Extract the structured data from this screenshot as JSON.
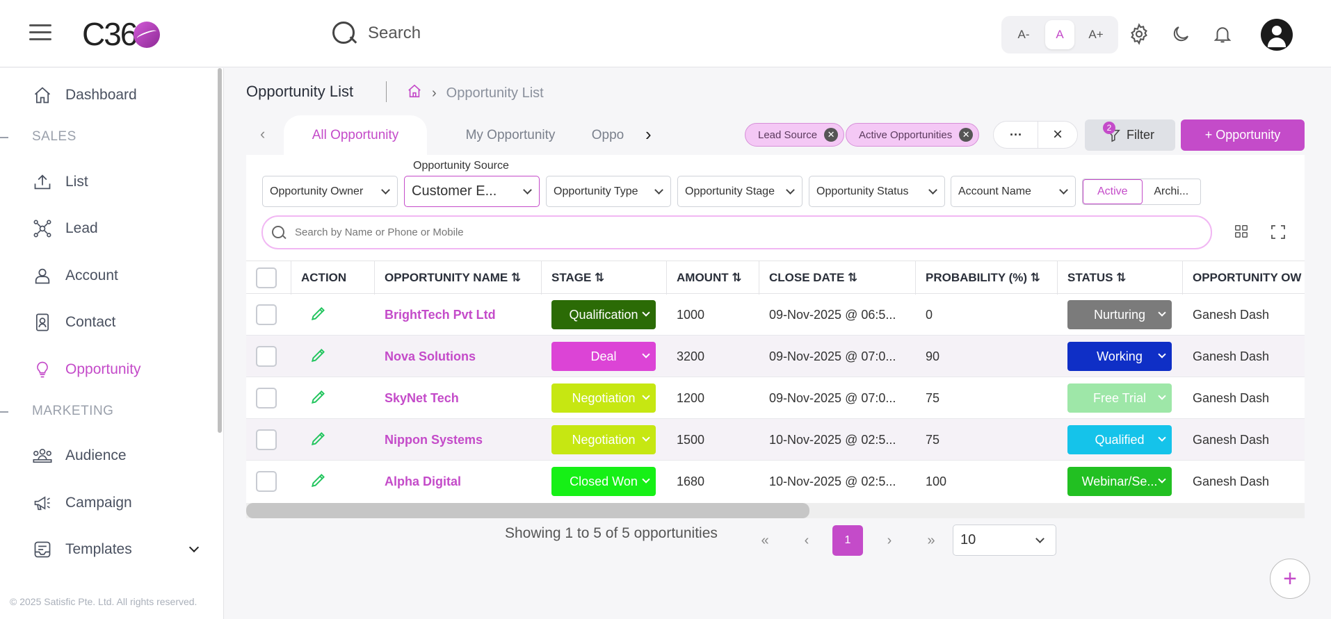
{
  "header": {
    "logo": "C36",
    "search_label": "Search",
    "font_controls": [
      "A-",
      "A",
      "A+"
    ]
  },
  "sidebar": {
    "items": [
      {
        "label": "Dashboard",
        "icon": "home-icon"
      },
      {
        "section": "SALES"
      },
      {
        "label": "List",
        "icon": "upload-icon"
      },
      {
        "label": "Lead",
        "icon": "lead-network-icon"
      },
      {
        "label": "Account",
        "icon": "account-user-icon"
      },
      {
        "label": "Contact",
        "icon": "contact-card-icon"
      },
      {
        "label": "Opportunity",
        "icon": "lightbulb-icon",
        "active": true
      },
      {
        "section": "MARKETING"
      },
      {
        "label": "Audience",
        "icon": "audience-group-icon"
      },
      {
        "label": "Campaign",
        "icon": "megaphone-icon"
      },
      {
        "label": "Templates",
        "icon": "templates-icon"
      }
    ],
    "footer": "© 2025 Satisfic Pte. Ltd. All rights reserved."
  },
  "page": {
    "title": "Opportunity List",
    "breadcrumb_current": "Opportunity List"
  },
  "tabs": [
    "All Opportunity",
    "My Opportunity",
    "Oppo"
  ],
  "chips": [
    "Lead Source",
    "Active Opportunities"
  ],
  "toolbar": {
    "more": "···",
    "clear": "×",
    "filter_label": "Filter",
    "filter_count": "2",
    "add_label": "+ Opportunity"
  },
  "filters": {
    "source_label": "Opportunity Source",
    "items": [
      "Opportunity Owner",
      "Customer E...",
      "Opportunity Type",
      "Opportunity Stage",
      "Opportunity Status",
      "Account Name"
    ],
    "toggle": [
      "Active",
      "Archi..."
    ]
  },
  "search": {
    "placeholder": "Search by Name or Phone or Mobile"
  },
  "table": {
    "columns": [
      "ACTION",
      "OPPORTUNITY NAME ⇅",
      "STAGE ⇅",
      "AMOUNT ⇅",
      "CLOSE DATE ⇅",
      "PROBABILITY (%) ⇅",
      "STATUS ⇅",
      "OPPORTUNITY OW"
    ],
    "rows": [
      {
        "name": "BrightTech Pvt Ltd",
        "stage": "Qualification",
        "stage_color": "#2b6b06",
        "amount": "1000",
        "close": "09-Nov-2025 @ 06:5...",
        "prob": "0",
        "status": "Nurturing",
        "status_color": "#7b7b7b",
        "owner": "Ganesh Dash"
      },
      {
        "name": "Nova Solutions",
        "stage": "Deal",
        "stage_color": "#dc44d6",
        "amount": "3200",
        "close": "09-Nov-2025 @ 07:0...",
        "prob": "90",
        "status": "Working",
        "status_color": "#0f2fc6",
        "owner": "Ganesh Dash"
      },
      {
        "name": "SkyNet Tech",
        "stage": "Negotiation",
        "stage_color": "#c6e712",
        "amount": "1200",
        "close": "09-Nov-2025 @ 07:0...",
        "prob": "75",
        "status": "Free Trial",
        "status_color": "#9ee7a8",
        "owner": "Ganesh Dash"
      },
      {
        "name": "Nippon Systems",
        "stage": "Negotiation",
        "stage_color": "#c6e712",
        "amount": "1500",
        "close": "10-Nov-2025 @ 02:5...",
        "prob": "75",
        "status": "Qualified",
        "status_color": "#15c3ea",
        "owner": "Ganesh Dash"
      },
      {
        "name": "Alpha Digital",
        "stage": "Closed Won",
        "stage_color": "#16f016",
        "amount": "1680",
        "close": "10-Nov-2025 @ 02:5...",
        "prob": "100",
        "status": "Webinar/Se...",
        "status_color": "#22c022",
        "owner": "Ganesh Dash"
      }
    ]
  },
  "pagination": {
    "summary": "Showing 1 to 5 of 5 opportunities",
    "page": "1",
    "page_size": "10"
  }
}
